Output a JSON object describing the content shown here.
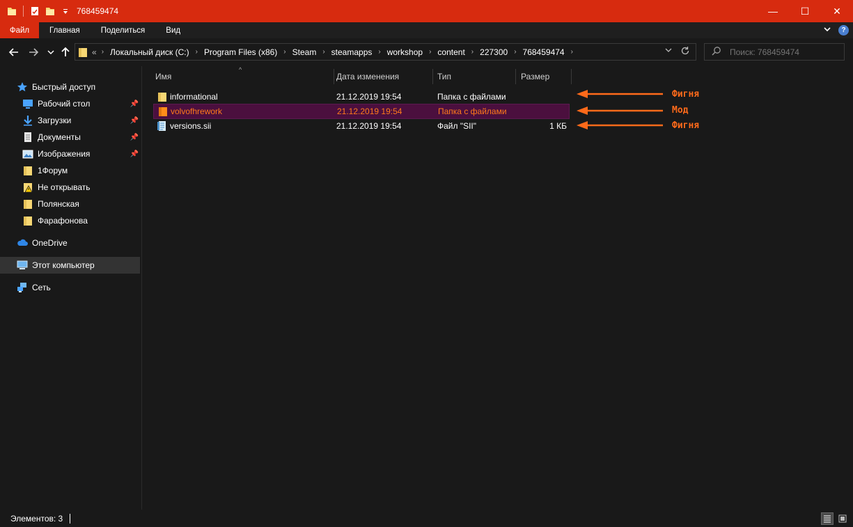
{
  "window": {
    "title": "768459474",
    "controls": {
      "minimize": "—",
      "maximize": "☐",
      "close": "✕"
    }
  },
  "ribbon": {
    "tabs": [
      "Файл",
      "Главная",
      "Поделиться",
      "Вид"
    ],
    "help_label": "?"
  },
  "address": {
    "overflow": "«",
    "crumbs": [
      "Локальный диск (C:)",
      "Program Files (x86)",
      "Steam",
      "steamapps",
      "workshop",
      "content",
      "227300",
      "768459474"
    ]
  },
  "search": {
    "placeholder": "Поиск: 768459474"
  },
  "nav": {
    "quick_access": "Быстрый доступ",
    "pinned": [
      {
        "label": "Рабочий стол",
        "icon": "desktop-icon",
        "pinned": true
      },
      {
        "label": "Загрузки",
        "icon": "downloads-icon",
        "pinned": true
      },
      {
        "label": "Документы",
        "icon": "documents-icon",
        "pinned": true
      },
      {
        "label": "Изображения",
        "icon": "pictures-icon",
        "pinned": true
      },
      {
        "label": "1Форум",
        "icon": "folder-icon",
        "pinned": false
      },
      {
        "label": "Не открывать",
        "icon": "warning-folder-icon",
        "pinned": false
      },
      {
        "label": "Полянская",
        "icon": "folder-icon",
        "pinned": false
      },
      {
        "label": "Фарафонова",
        "icon": "folder-icon",
        "pinned": false
      }
    ],
    "onedrive": "OneDrive",
    "this_pc": "Этот компьютер",
    "network": "Сеть"
  },
  "columns": {
    "name": "Имя",
    "date": "Дата изменения",
    "type": "Тип",
    "size": "Размер"
  },
  "files": [
    {
      "name": "informational",
      "date": "21.12.2019 19:54",
      "type": "Папка с файлами",
      "size": "",
      "kind": "folder"
    },
    {
      "name": "volvofhrework",
      "date": "21.12.2019 19:54",
      "type": "Папка с файлами",
      "size": "",
      "kind": "folder"
    },
    {
      "name": "versions.sii",
      "date": "21.12.2019 19:54",
      "type": "Файл \"SII\"",
      "size": "1 КБ",
      "kind": "file"
    }
  ],
  "annotations": [
    "Фигня",
    "Мод",
    "Фигня"
  ],
  "status": {
    "items": "Элементов: 3"
  },
  "colors": {
    "accent": "#d72b0f",
    "selected_row": "#4b0f3e",
    "selected_text": "#ff7a1a",
    "annotation": "#ff6a1a",
    "folder": "#f7d774"
  }
}
